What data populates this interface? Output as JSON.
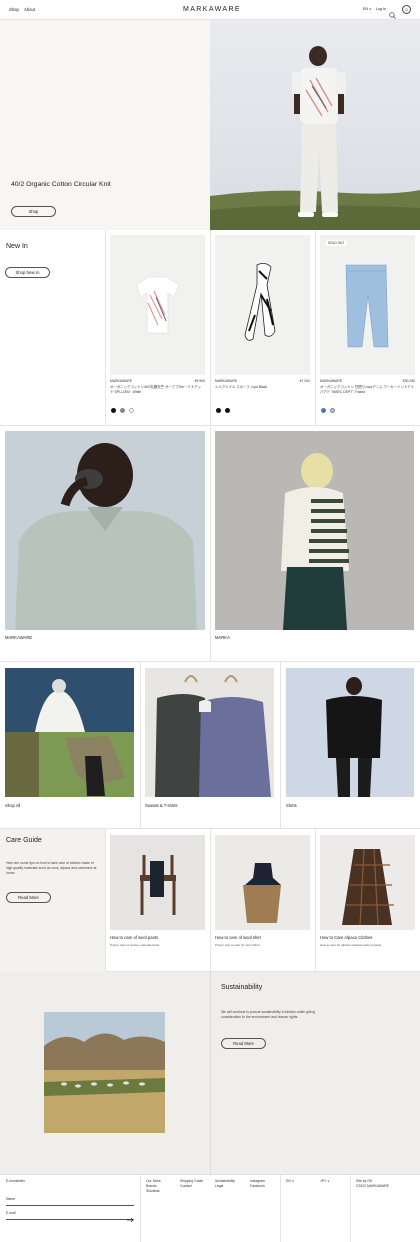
{
  "header": {
    "nav": [
      "Shop",
      "About"
    ],
    "logo": "MARKAWARE",
    "lang": "EN ∨",
    "login": "Log In",
    "cart_count": "0"
  },
  "hero": {
    "title": "40/2 Organic Cotton Circular Knit",
    "button": "Shop"
  },
  "new_in": {
    "title": "New In",
    "button": "Shop New In",
    "products": [
      {
        "brand": "MARKAWARE",
        "price": "¥9,900",
        "name": "オーガニックコットン40/2丸胴天竺 サークプTee－ミナアッ ト\"SPU-ZEN\", White",
        "badge": ""
      },
      {
        "brand": "MARKAWARE",
        "price": "¥7,000",
        "name": "シルクツイル スカーフ, Lipd Black",
        "badge": ""
      },
      {
        "brand": "MARKAWARE",
        "price": "¥30,250",
        "name": "オーガニックコットン 甘撚り14ozデニム ワーカーミントテイパアド \"MARC DEPT\", Faded",
        "badge": "SOLD OUT"
      }
    ]
  },
  "brands": [
    {
      "label": "MARKAWARE"
    },
    {
      "label": "MARKA"
    }
  ],
  "categories": [
    {
      "label": "Shop All"
    },
    {
      "label": "Sweats & T-shirts"
    },
    {
      "label": "Shirts"
    }
  ],
  "care": {
    "title": "Care Guide",
    "desc": "Here are some tips on how to take care of clothes made of high quality materials such as wool, alpaca and cashmere at home.",
    "button": "Read More",
    "items": [
      {
        "title": "How to care of wool pants",
        "sub": "Proper care of woolen material pants"
      },
      {
        "title": "How to care of wool shirt",
        "sub": "Proper way to care for wool shirts."
      },
      {
        "title": "How to Care Alpaca Clothes",
        "sub": "How to care for alpaca material coats properly."
      }
    ]
  },
  "sustain": {
    "title": "Sustainability",
    "desc": "We will continue to pursue sustainability in fashion while giving consideration to the environment and human rights.",
    "button": "Read More"
  },
  "footer": {
    "newsletter": "E-newsletter",
    "name_label": "Name",
    "email_label": "E-mail",
    "col1": [
      "Our Store",
      "Brands",
      "Stockists"
    ],
    "col2": [
      "Shipping Guide",
      "Contact"
    ],
    "col3": [
      "Sustainability",
      "Legal"
    ],
    "col4": [
      "Instagram",
      "Facebook"
    ],
    "region": "EN ∨",
    "currency": "JPY ∨",
    "site": "Site by OK",
    "copyright": "©2022 MARKAWARE"
  }
}
